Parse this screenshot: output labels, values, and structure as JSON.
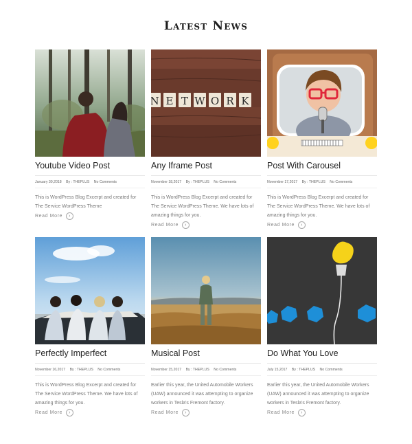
{
  "heading": "Latest News",
  "posts": [
    {
      "title": "Youtube Video Post",
      "date": "January 30,2018",
      "author": "By : THEPLUS",
      "comments": "No Comments",
      "excerpt": "This is WordPress Blog Excerpt and created for The Service WordPress Theme",
      "read_more": "Read More",
      "image": "forest-couple"
    },
    {
      "title": "Any Iframe Post",
      "date": "November 18,2017",
      "author": "By : THEPLUS",
      "comments": "No Comments",
      "excerpt": "This is WordPress Blog Excerpt and created for The Service WordPress Theme. We have lots of amazing things for you.",
      "read_more": "Read More",
      "image": "network-tiles",
      "tile_letters": [
        "N",
        "E",
        "T",
        "W",
        "O",
        "R",
        "K"
      ]
    },
    {
      "title": "Post With Carousel",
      "date": "November 17,2017",
      "author": "By : THEPLUS",
      "comments": "No Comments",
      "excerpt": "This is WordPress Blog Excerpt and created for The Service WordPress Theme. We have lots of amazing things for you.",
      "read_more": "Read More",
      "image": "kid-tv-microphone"
    },
    {
      "title": "Perfectly Imperfect",
      "date": "November 16,2017",
      "author": "By : THEPLUS",
      "comments": "No Comments",
      "excerpt": "This is WordPress Blog Excerpt and created for The Service WordPress Theme. We have lots of amazing things for you.",
      "read_more": "Read More",
      "image": "friends-convertible"
    },
    {
      "title": "Musical Post",
      "date": "November 15,2017",
      "author": "By : THEPLUS",
      "comments": "No Comments",
      "excerpt": "Earlier this year, the United Automobile Workers (UAW) announced it was attempting to organize workers in Tesla's Fremont factory.",
      "read_more": "Read More",
      "image": "woman-desert"
    },
    {
      "title": "Do What You Love",
      "date": "July 15,2017",
      "author": "By : THEPLUS",
      "comments": "No Comments",
      "excerpt": "Earlier this year, the United Automobile Workers (UAW) announced it was attempting to organize workers in Tesla's Fremont factory.",
      "read_more": "Read More",
      "image": "paper-lightbulb"
    }
  ]
}
